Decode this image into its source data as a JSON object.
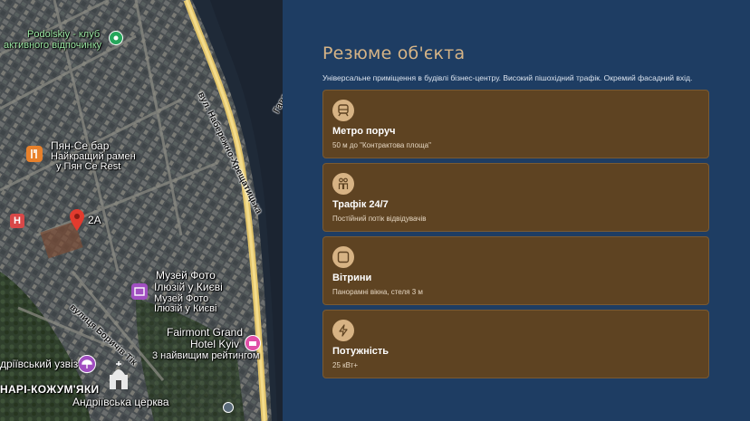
{
  "map": {
    "labels": {
      "podolskiy_1": "Podolskiy - клуб",
      "podolskiy_2": "активного відпочинку",
      "bar_name": "Пян-Се бар",
      "bar_sub1": "Найкращий рамен",
      "bar_sub2": "у Пян Се Rest",
      "pin": "2A",
      "museum_1": "Музей Фото",
      "museum_2": "Ілюзій у Києві",
      "museum_sub1": "Музей Фото",
      "museum_sub2": "Ілюзій у Києві",
      "hotel_1": "Fairmont Grand",
      "hotel_2": "Hotel Kyiv",
      "hotel_sub": "3 найвищим рейтингом",
      "uzviz": "дріївський узвіз",
      "district": "НАРІ-КОЖУМ'ЯКИ",
      "church": "Андріївська церква",
      "h_marker": "H"
    },
    "roads": {
      "naberezhno": "вул. Набережно-Хрещатицька",
      "havanskyi": "Гаванський",
      "borychiv": "вулиця Боричів Тік"
    }
  },
  "panel": {
    "title": "Резюме об'єкта",
    "description": "Універсальне приміщення в будівлі бізнес-центру. Високий пішохідний трафік. Окремий фасадний вхід.",
    "cards": [
      {
        "icon": "metro-icon",
        "title": "Метро поруч",
        "subtitle": "50 м до \"Контрактова площа\""
      },
      {
        "icon": "people-icon",
        "title": "Трафік 24/7",
        "subtitle": "Постійний потік відвідувачів"
      },
      {
        "icon": "window-icon",
        "title": "Вітрини",
        "subtitle": "Панорамні вікна, стеля 3 м"
      },
      {
        "icon": "lightning-icon",
        "title": "Потужність",
        "subtitle": "25 кВт+"
      }
    ]
  }
}
